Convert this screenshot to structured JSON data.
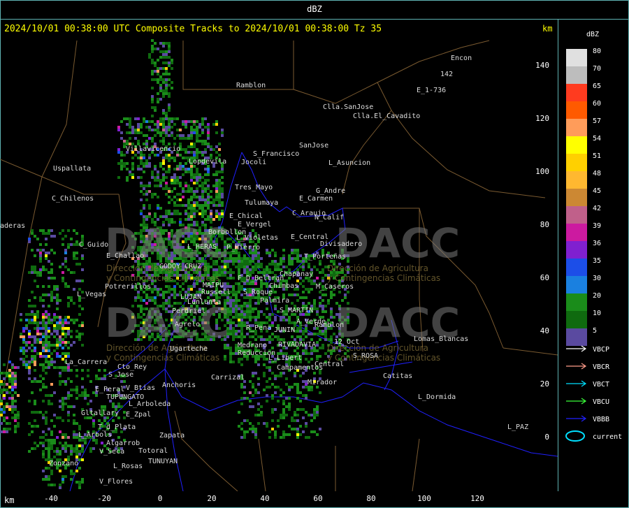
{
  "window": {
    "title": "dBZ"
  },
  "header": {
    "text": "2024/10/01 00:38:00 UTC Composite Tracks to 2024/10/01 00:38:00 Tz 35",
    "unit_top": "km",
    "unit_bottom": "km"
  },
  "axes": {
    "x_ticks": [
      "-40",
      "-20",
      "0",
      "20",
      "40",
      "60",
      "80",
      "100",
      "120"
    ],
    "y_ticks": [
      "140",
      "120",
      "100",
      "80",
      "60",
      "40",
      "20",
      "0"
    ]
  },
  "legend": {
    "title": "dBZ",
    "levels": [
      {
        "label": "80",
        "color": "#e0e0e0"
      },
      {
        "label": "70",
        "color": "#bdbdbd"
      },
      {
        "label": "65",
        "color": "#ff3b1f"
      },
      {
        "label": "60",
        "color": "#ff5a00"
      },
      {
        "label": "57",
        "color": "#ff9c5a"
      },
      {
        "label": "54",
        "color": "#ffff00"
      },
      {
        "label": "51",
        "color": "#ffd000"
      },
      {
        "label": "48",
        "color": "#ffb830"
      },
      {
        "label": "45",
        "color": "#cc8833"
      },
      {
        "label": "42",
        "color": "#c0608a"
      },
      {
        "label": "39",
        "color": "#cc1aa0"
      },
      {
        "label": "36",
        "color": "#8020d0"
      },
      {
        "label": "35",
        "color": "#1c4ee8"
      },
      {
        "label": "30",
        "color": "#1a80e0"
      },
      {
        "label": "20",
        "color": "#1a8c1a"
      },
      {
        "label": "10",
        "color": "#0f6a0f"
      },
      {
        "label": "5",
        "color": "#5a4aa0"
      }
    ],
    "tracks": [
      {
        "label": "VBCP",
        "color": "#ffffff"
      },
      {
        "label": "VBCR",
        "color": "#ff9c8a"
      },
      {
        "label": "VBCT",
        "color": "#00e0ff"
      },
      {
        "label": "VBCU",
        "color": "#3aff3a"
      },
      {
        "label": "VBBB",
        "color": "#2020ff"
      },
      {
        "label": "current",
        "color": "#00e0ff"
      }
    ]
  },
  "watermark": {
    "brand": "DACC",
    "line1": "Dirección de Agricultura",
    "line2": "y Contingencias Climáticas"
  },
  "places": [
    {
      "name": "Ramblon",
      "x": 338,
      "y": 117
    },
    {
      "name": "Encon",
      "x": 645,
      "y": 78
    },
    {
      "name": "142",
      "x": 630,
      "y": 101
    },
    {
      "name": "E_1-736",
      "x": 596,
      "y": 124
    },
    {
      "name": "Clla.SanJose",
      "x": 462,
      "y": 148
    },
    {
      "name": "Clla.El_Cavadito",
      "x": 505,
      "y": 161
    },
    {
      "name": "Villavicencio",
      "x": 180,
      "y": 208
    },
    {
      "name": "S_Francisco",
      "x": 362,
      "y": 215
    },
    {
      "name": "SanJose",
      "x": 428,
      "y": 203
    },
    {
      "name": "Jocoli",
      "x": 345,
      "y": 227
    },
    {
      "name": "Lopdevila",
      "x": 270,
      "y": 226
    },
    {
      "name": "L_Asuncion",
      "x": 470,
      "y": 228
    },
    {
      "name": "Uspallata",
      "x": 76,
      "y": 236
    },
    {
      "name": "Tres_Mayo",
      "x": 336,
      "y": 263
    },
    {
      "name": "G_Andre",
      "x": 452,
      "y": 268
    },
    {
      "name": "Tulumaya",
      "x": 350,
      "y": 285
    },
    {
      "name": "E_Carmen",
      "x": 428,
      "y": 279
    },
    {
      "name": "C_Chilenos",
      "x": 74,
      "y": 279
    },
    {
      "name": "E_Chical",
      "x": 328,
      "y": 304
    },
    {
      "name": "C_Araujo",
      "x": 418,
      "y": 300
    },
    {
      "name": "N_Calif",
      "x": 450,
      "y": 306
    },
    {
      "name": "E_Vergel",
      "x": 340,
      "y": 316
    },
    {
      "name": "Borbollon",
      "x": 298,
      "y": 327
    },
    {
      "name": "L_Violetas",
      "x": 338,
      "y": 335
    },
    {
      "name": "E_Central",
      "x": 416,
      "y": 334
    },
    {
      "name": "Divisadero",
      "x": 458,
      "y": 344
    },
    {
      "name": "C_Guido",
      "x": 113,
      "y": 345
    },
    {
      "name": "L_HERAS",
      "x": 268,
      "y": 348
    },
    {
      "name": "P_Hierro",
      "x": 324,
      "y": 349
    },
    {
      "name": "E_Challao",
      "x": 152,
      "y": 361
    },
    {
      "name": "T_Porteñas",
      "x": 435,
      "y": 362
    },
    {
      "name": "GODOY_CRUZ",
      "x": 228,
      "y": 376
    },
    {
      "name": "Chapanay",
      "x": 400,
      "y": 387
    },
    {
      "name": "F_D_Beltran",
      "x": 340,
      "y": 393
    },
    {
      "name": "MAIPU",
      "x": 290,
      "y": 403
    },
    {
      "name": "Chimbas",
      "x": 385,
      "y": 404
    },
    {
      "name": "M_Caseros",
      "x": 452,
      "y": 405
    },
    {
      "name": "Potrerillos",
      "x": 150,
      "y": 405
    },
    {
      "name": "S_Roque",
      "x": 348,
      "y": 413
    },
    {
      "name": "L_Vegas",
      "x": 110,
      "y": 416
    },
    {
      "name": "LUJAN",
      "x": 258,
      "y": 420
    },
    {
      "name": "Russell",
      "x": 288,
      "y": 413
    },
    {
      "name": "Lunlunta",
      "x": 268,
      "y": 427
    },
    {
      "name": "Palmira",
      "x": 372,
      "y": 425
    },
    {
      "name": "S_MARTIN",
      "x": 400,
      "y": 439
    },
    {
      "name": "Perdriel",
      "x": 246,
      "y": 440
    },
    {
      "name": "A_Verde",
      "x": 424,
      "y": 455
    },
    {
      "name": "Agrelo",
      "x": 250,
      "y": 459
    },
    {
      "name": "R_Pena",
      "x": 352,
      "y": 464
    },
    {
      "name": "JUNIN",
      "x": 392,
      "y": 467
    },
    {
      "name": "Ramblon",
      "x": 450,
      "y": 460
    },
    {
      "name": "Lomas_Blancas",
      "x": 592,
      "y": 480
    },
    {
      "name": "12_Oct",
      "x": 478,
      "y": 484
    },
    {
      "name": "Medrano",
      "x": 340,
      "y": 489
    },
    {
      "name": "RIVADAVIA",
      "x": 398,
      "y": 488
    },
    {
      "name": "Ugarteche",
      "x": 243,
      "y": 494
    },
    {
      "name": "Reduccion",
      "x": 340,
      "y": 500
    },
    {
      "name": "S_ROSA",
      "x": 505,
      "y": 504
    },
    {
      "name": "L_Libert",
      "x": 384,
      "y": 507
    },
    {
      "name": "La_Carrera",
      "x": 93,
      "y": 513
    },
    {
      "name": "Central",
      "x": 450,
      "y": 516
    },
    {
      "name": "Cto_Rey",
      "x": 168,
      "y": 520
    },
    {
      "name": "Campamentos",
      "x": 396,
      "y": 521
    },
    {
      "name": "S_Jose",
      "x": 155,
      "y": 531
    },
    {
      "name": "Carrizal",
      "x": 302,
      "y": 535
    },
    {
      "name": "Catitas",
      "x": 548,
      "y": 533
    },
    {
      "name": "Mirador",
      "x": 440,
      "y": 542
    },
    {
      "name": "Anchoris",
      "x": 232,
      "y": 546
    },
    {
      "name": "E_Peral",
      "x": 136,
      "y": 552
    },
    {
      "name": "V_Btias",
      "x": 180,
      "y": 550
    },
    {
      "name": "TUPUNGATO",
      "x": 152,
      "y": 563
    },
    {
      "name": "L_Dormida",
      "x": 598,
      "y": 563
    },
    {
      "name": "L_Arboleda",
      "x": 184,
      "y": 573
    },
    {
      "name": "Gltallary",
      "x": 116,
      "y": 586
    },
    {
      "name": "E_Zpal",
      "x": 180,
      "y": 588
    },
    {
      "name": "T_d_Plata",
      "x": 140,
      "y": 606
    },
    {
      "name": "L_PAZ",
      "x": 726,
      "y": 606
    },
    {
      "name": "L_Arbols",
      "x": 112,
      "y": 617
    },
    {
      "name": "Zapata",
      "x": 228,
      "y": 618
    },
    {
      "name": "Algarrob",
      "x": 152,
      "y": 629
    },
    {
      "name": "Totoral",
      "x": 198,
      "y": 640
    },
    {
      "name": "V_Seca",
      "x": 142,
      "y": 641
    },
    {
      "name": "TUNUYAN",
      "x": 212,
      "y": 655
    },
    {
      "name": "Zonzano",
      "x": 70,
      "y": 658
    },
    {
      "name": "L_Rosas",
      "x": 162,
      "y": 662
    },
    {
      "name": "V_Flores",
      "x": 142,
      "y": 684
    },
    {
      "name": "aderas",
      "x": 0,
      "y": 318
    }
  ]
}
